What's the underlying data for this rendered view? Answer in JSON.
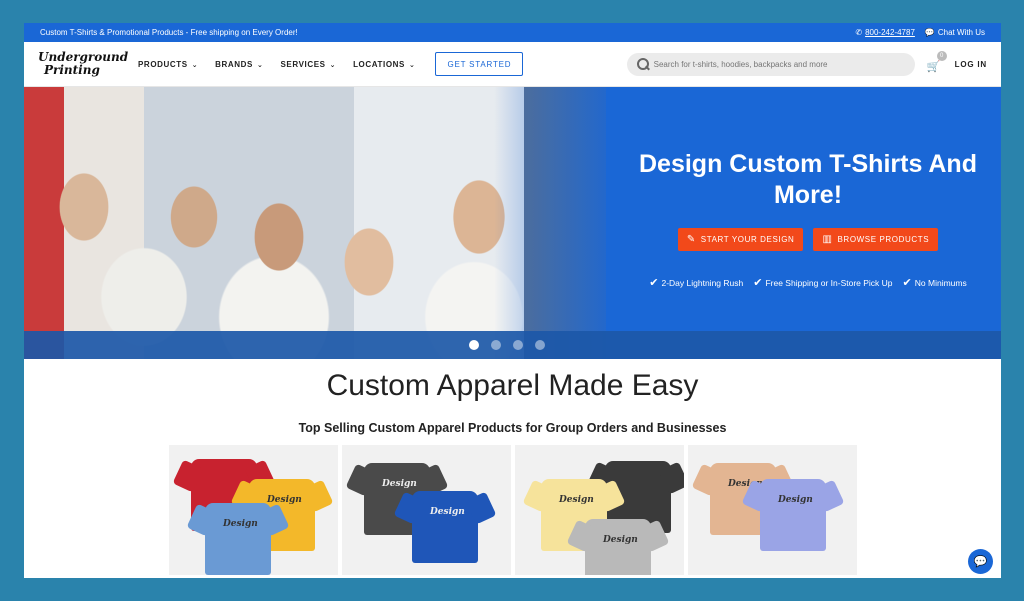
{
  "topbar": {
    "promo": "Custom T-Shirts & Promotional Products - Free shipping on Every Order!",
    "phone": "800-242-4787",
    "chat": "Chat With Us"
  },
  "header": {
    "logo_line1": "Underground",
    "logo_line2": "Printing",
    "nav": [
      {
        "label": "PRODUCTS"
      },
      {
        "label": "BRANDS"
      },
      {
        "label": "SERVICES"
      },
      {
        "label": "LOCATIONS"
      }
    ],
    "cta": "GET STARTED",
    "search_placeholder": "Search for t-shirts, hoodies, backpacks and more",
    "cart_count": "0",
    "login": "LOG IN"
  },
  "hero": {
    "headline": "Design Custom T-Shirts And More!",
    "btn_design": "START YOUR DESIGN",
    "btn_browse": "BROWSE PRODUCTS",
    "features": [
      "2-Day Lightning Rush",
      "Free Shipping or In-Store Pick Up",
      "No Minimums"
    ],
    "slides": 4,
    "active_slide": 1
  },
  "section": {
    "title": "Custom Apparel Made Easy",
    "subtitle": "Top Selling Custom Apparel Products for Group Orders and Businesses"
  },
  "product_print": "Design",
  "colors": {
    "brand_blue": "#1a67d6",
    "accent_orange": "#f2491a"
  }
}
